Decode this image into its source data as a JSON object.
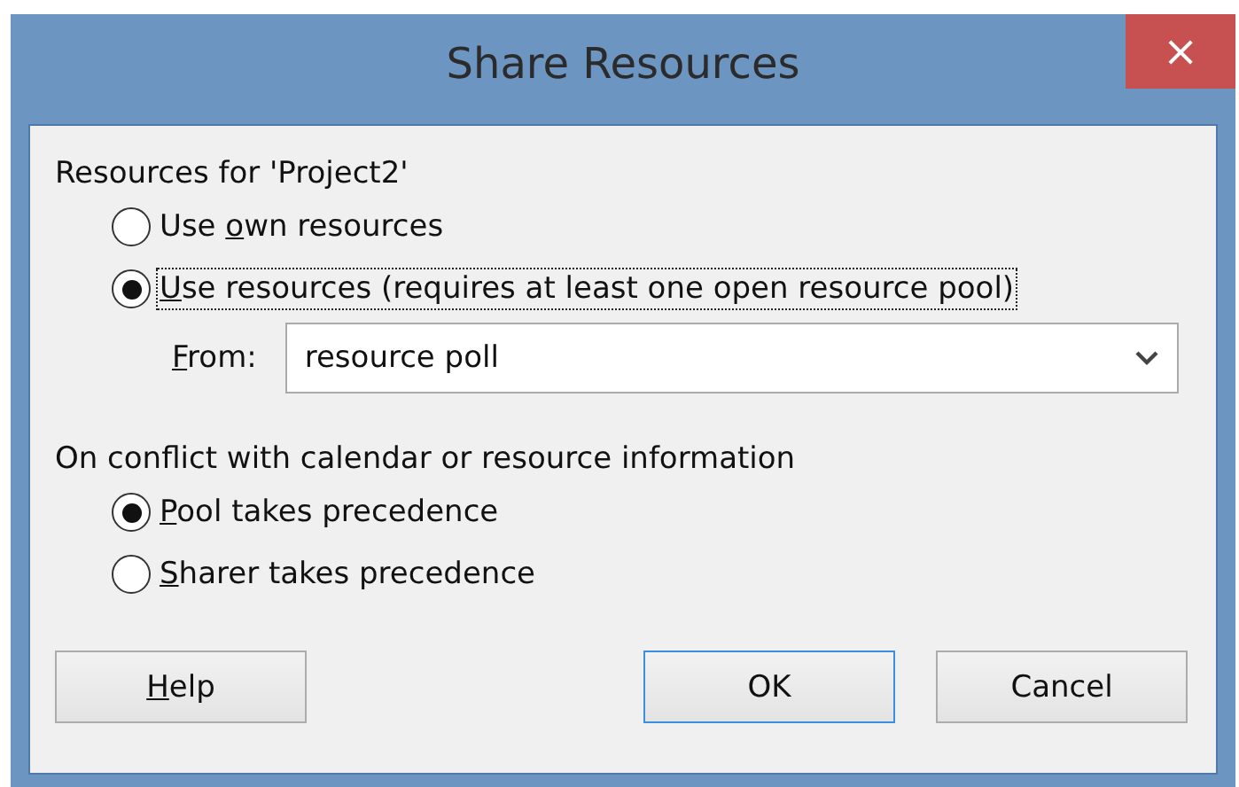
{
  "window": {
    "title": "Share Resources",
    "close": "×"
  },
  "resources_group": {
    "label": "Resources for 'Project2'",
    "options": [
      {
        "label": {
          "before": "Use ",
          "key": "o",
          "after": "wn resources"
        },
        "selected": false,
        "focused": false
      },
      {
        "label": {
          "key": "U",
          "after": "se resources (requires at least one open resource pool)"
        },
        "selected": true,
        "focused": true
      }
    ],
    "from": {
      "label": {
        "key": "F",
        "after": "rom:"
      },
      "value": "resource poll"
    }
  },
  "conflict_group": {
    "label": "On conflict with calendar or resource information",
    "options": [
      {
        "label": {
          "key": "P",
          "after": "ool takes precedence"
        },
        "selected": true,
        "focused": false
      },
      {
        "label": {
          "key": "S",
          "after": "harer takes precedence"
        },
        "selected": false,
        "focused": false
      }
    ]
  },
  "buttons": [
    {
      "label": {
        "key": "H",
        "after": "elp"
      },
      "default": false
    },
    {
      "label": {
        "after": "OK"
      },
      "default": true
    },
    {
      "label": {
        "after": "Cancel"
      },
      "default": false
    }
  ]
}
